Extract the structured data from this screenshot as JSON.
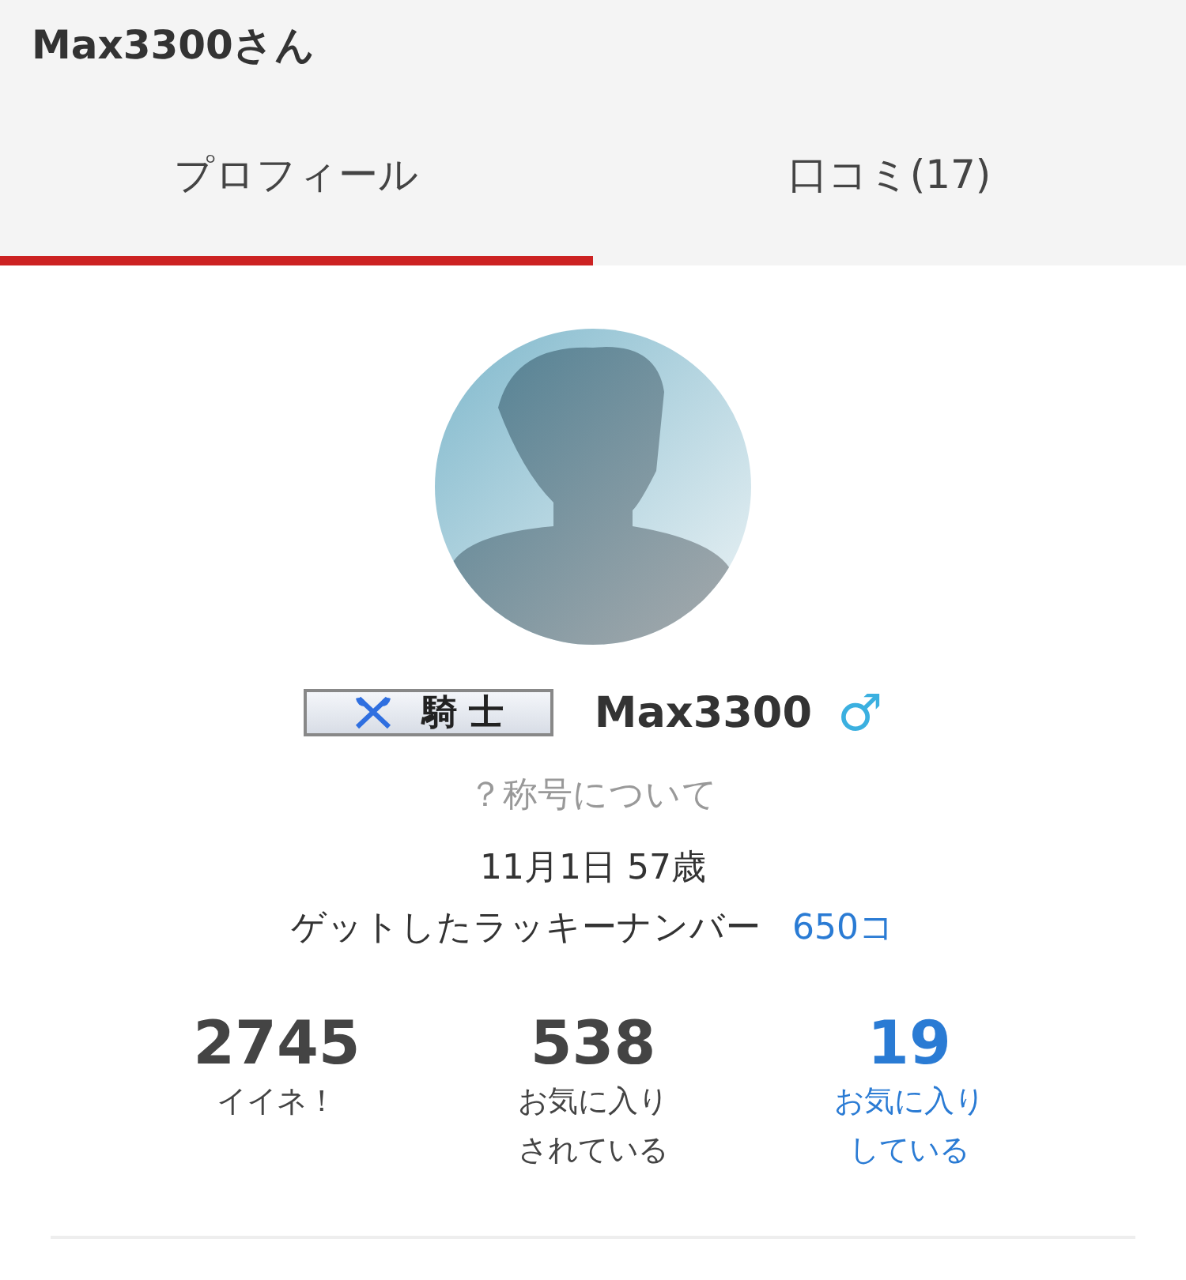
{
  "header": {
    "title": "Max3300さん"
  },
  "tabs": [
    {
      "label": "プロフィール",
      "selected": true
    },
    {
      "label": "口コミ(17)",
      "selected": false
    }
  ],
  "profile": {
    "rank_badge": "騎 士",
    "name": "Max3300",
    "gender_symbol": "♂",
    "rank_help": "？称号について",
    "birthday_age": "11月1日 57歳",
    "lucky_label": "ゲットしたラッキーナンバー",
    "lucky_count": "650コ"
  },
  "stats": [
    {
      "value": "2745",
      "label": "イイネ！",
      "link": false
    },
    {
      "value": "538",
      "label": "お気に入りされている",
      "link": false
    },
    {
      "value": "19",
      "label": "お気に入りしている",
      "link": true
    }
  ]
}
